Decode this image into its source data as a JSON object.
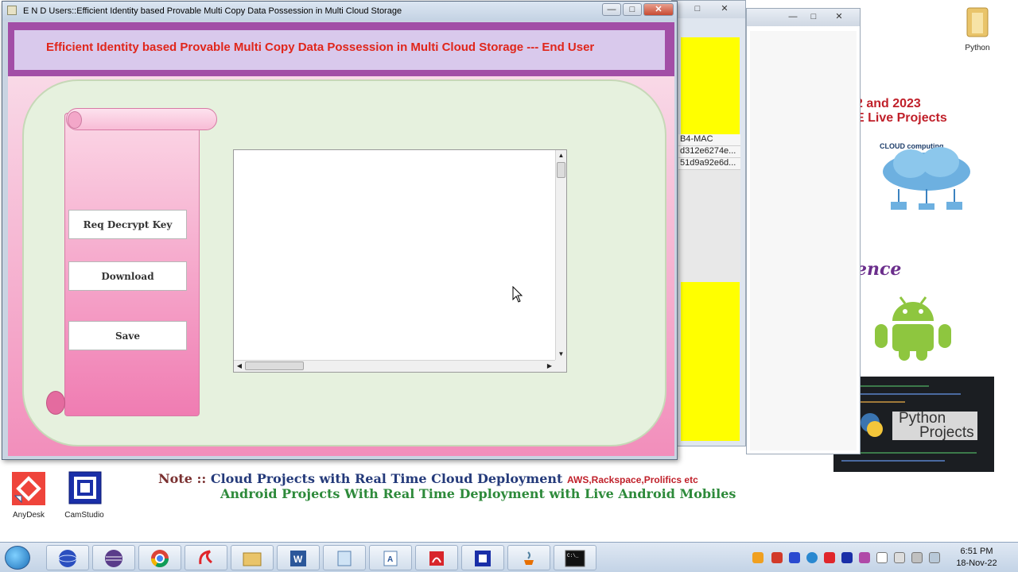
{
  "main_window": {
    "title": "E N D Users::Efficient Identity based Provable Multi Copy Data Possession in Multi Cloud Storage",
    "header": "Efficient Identity based Provable Multi Copy Data Possession in Multi Cloud Storage --- End User",
    "buttons": {
      "req_decrypt_key": "Req Decrypt Key",
      "download": "Download",
      "save": "Save"
    },
    "text_area": {
      "value": ""
    }
  },
  "background_window": {
    "list_rows": [
      "B4-MAC",
      "d312e6274e...",
      "51d9a92e6d..."
    ]
  },
  "wallpaper": {
    "year_banner": "2 and 2023",
    "live_projects": "E Live Projects",
    "ence": "ence",
    "python_projects_line1": "Python",
    "python_projects_line2": "Projects",
    "cloud_label": "CLOUD computing",
    "note_prefix": "Note ::",
    "note_line1": "Cloud Projects with Real Time Cloud Deployment",
    "note_line1_suffix": "AWS,Rackspace,Prolifics etc",
    "note_line2": "Android Projects With Real Time Deployment with Live Android Mobiles"
  },
  "desktop_icons": {
    "python": "Python",
    "anydesk": "AnyDesk",
    "camstudio": "CamStudio"
  },
  "taskbar": {
    "time": "6:51 PM",
    "date": "18-Nov-22"
  },
  "colors": {
    "header_text": "#e0261b",
    "header_bg": "#d9c9ec",
    "header_frame": "#a24ea6",
    "panel_green": "#e6f1de",
    "pink": "#f4a9c9",
    "yellow": "#ffff00",
    "android_green": "#8ec63f",
    "dotted_green": "#8dbb3c"
  }
}
